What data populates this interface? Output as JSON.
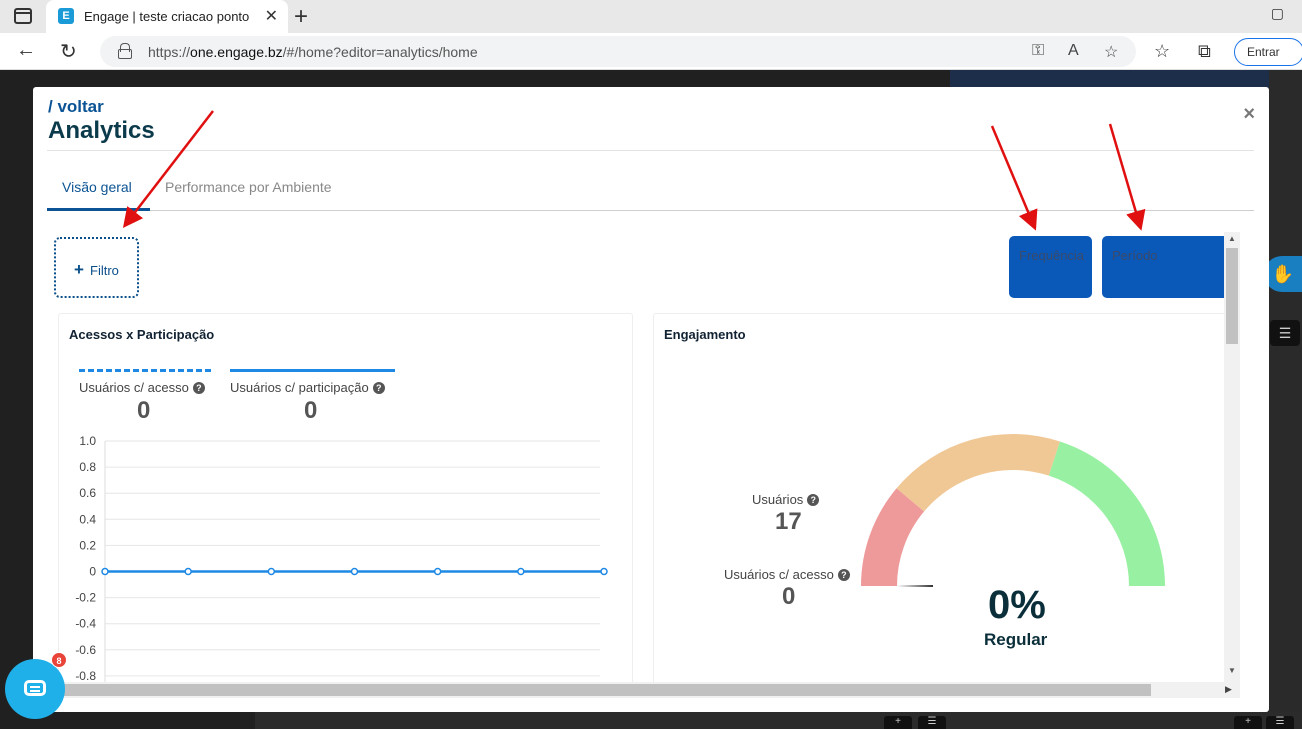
{
  "browser": {
    "tab_title": "Engage | teste criacao ponto",
    "tab_favicon": "E",
    "url_prefix": "https://",
    "url_domain": "one.engage.bz",
    "url_path": "/#/home?editor=analytics/home",
    "signin_label": "Entrar"
  },
  "modal": {
    "back_link": "/ voltar",
    "title": "Analytics",
    "close_glyph": "×"
  },
  "tabs": [
    {
      "label": "Visão geral",
      "active": true
    },
    {
      "label": "Performance por Ambiente",
      "active": false
    }
  ],
  "toolbar": {
    "filter_label": "Filtro",
    "frequency_label": "Frequência",
    "period_label": "Período",
    "button_color": "#0a58b8"
  },
  "access_card": {
    "title": "Acessos x Participação",
    "legend": [
      {
        "label": "Usuários c/ acesso",
        "value": "0",
        "style": "dashed"
      },
      {
        "label": "Usuários c/ participação",
        "value": "0",
        "style": "solid"
      }
    ],
    "chart_data": {
      "type": "line",
      "title": "",
      "xlabel": "",
      "ylabel": "",
      "ylim": [
        -0.8,
        1.0
      ],
      "yticks": [
        "1.0",
        "0.8",
        "0.6",
        "0.4",
        "0.2",
        "0",
        "-0.2",
        "-0.4",
        "-0.6",
        "-0.8"
      ],
      "grid": true,
      "series": [
        {
          "name": "Usuários c/ participação",
          "values": [
            0,
            0,
            0,
            0,
            0,
            0,
            0
          ],
          "color": "#1e88e5"
        }
      ]
    }
  },
  "engagement_card": {
    "title": "Engajamento",
    "users_label": "Usuários",
    "users_value": "17",
    "access_label": "Usuários c/ acesso",
    "access_value": "0",
    "gauge_percent": "0%",
    "gauge_status": "Regular",
    "gauge_value": 0,
    "gauge_colors": {
      "low": "#ef9a9a",
      "mid": "#f0c896",
      "high": "#98f0a2"
    }
  },
  "chat": {
    "badge_count": "8"
  }
}
